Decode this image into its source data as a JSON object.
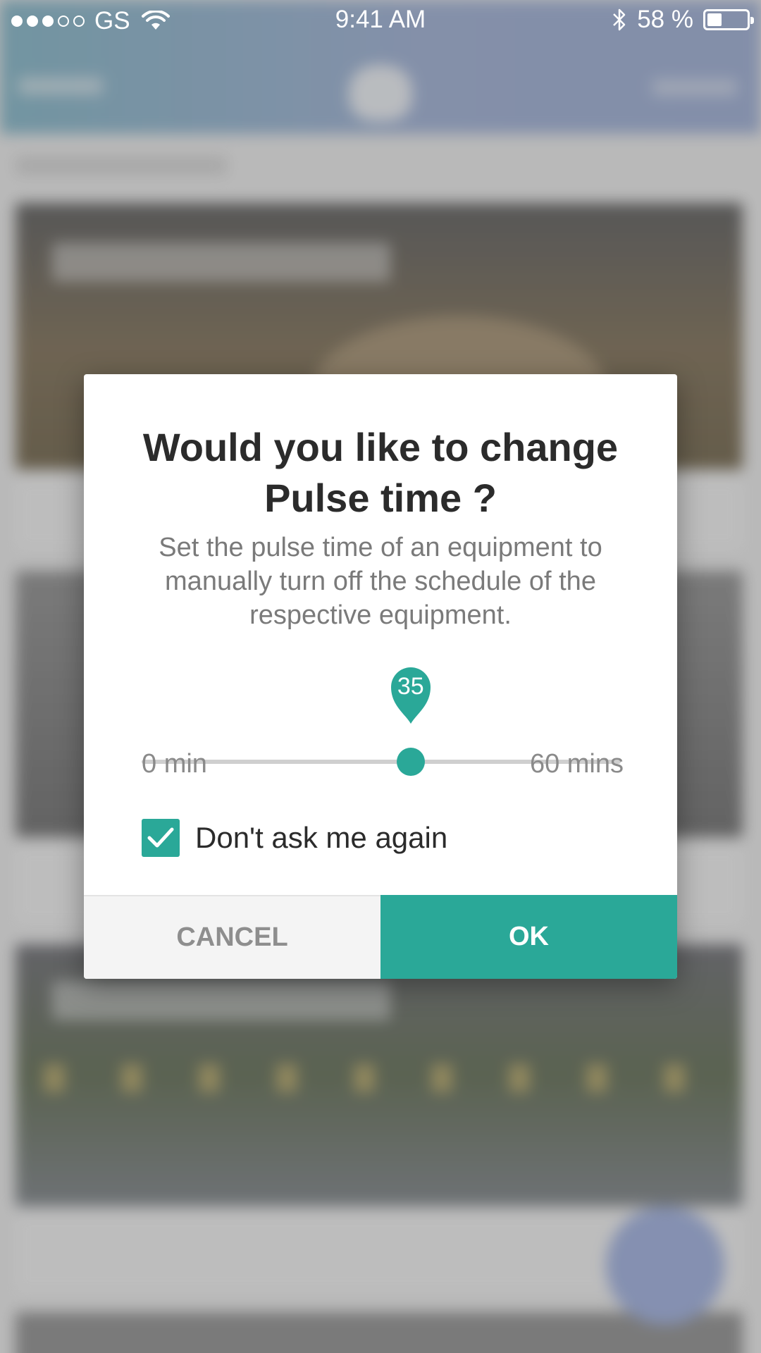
{
  "status_bar": {
    "carrier": "GS",
    "time": "9:41 AM",
    "battery": "58 %",
    "signal_bars_filled": 3,
    "signal_bars_total": 5
  },
  "background": {
    "note_visible_text": false
  },
  "dialog": {
    "title": "Would you like to change Pulse time ?",
    "description": "Set the pulse time of an equipment to manually turn off the schedule of the respective equipment.",
    "slider": {
      "value": "35",
      "value_fraction": 0.5614,
      "min_label": "0 min",
      "max_label": "60 mins"
    },
    "checkbox": {
      "checked": true,
      "label": "Don't ask me again"
    },
    "cancel_label": "CANCEL",
    "ok_label": "OK"
  },
  "colors": {
    "accent": "#2aa898",
    "header_start": "#8fbfd0",
    "header_end": "#a7b7dc",
    "fab": "#a9b9e6",
    "title_text": "#2b2b2b",
    "muted_text": "#7a7a7a"
  },
  "icons": {
    "wifi": "wifi-icon",
    "bluetooth": "bluetooth-icon",
    "battery": "battery-icon",
    "check": "check-icon"
  }
}
